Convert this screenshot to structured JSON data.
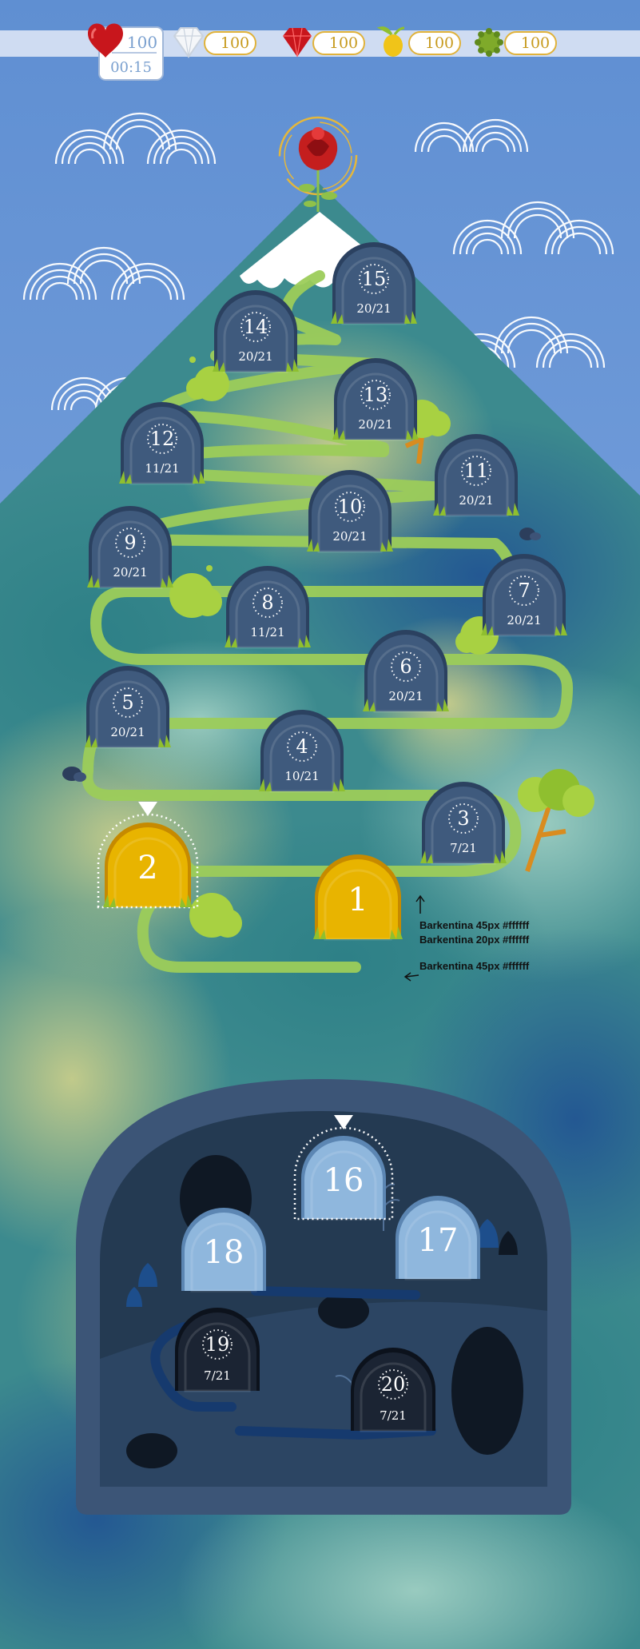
{
  "hud": {
    "lives": {
      "icon": "heart-icon",
      "value": "100",
      "timer": "00:15"
    },
    "currencies": [
      {
        "icon": "white-diamond-icon",
        "value": "100"
      },
      {
        "icon": "red-ruby-icon",
        "value": "100"
      },
      {
        "icon": "golden-fruit-icon",
        "value": "100"
      },
      {
        "icon": "green-gem-icon",
        "value": "100"
      }
    ]
  },
  "goal": {
    "icon": "red-rose-icon"
  },
  "levels": [
    {
      "id": "1",
      "number": "1",
      "state": "unlocked"
    },
    {
      "id": "2",
      "number": "2",
      "state": "current"
    },
    {
      "id": "3",
      "number": "3",
      "progress": "7/21",
      "state": "locked"
    },
    {
      "id": "4",
      "number": "4",
      "progress": "10/21",
      "state": "locked"
    },
    {
      "id": "5",
      "number": "5",
      "progress": "20/21",
      "state": "locked"
    },
    {
      "id": "6",
      "number": "6",
      "progress": "20/21",
      "state": "locked"
    },
    {
      "id": "7",
      "number": "7",
      "progress": "20/21",
      "state": "locked"
    },
    {
      "id": "8",
      "number": "8",
      "progress": "11/21",
      "state": "locked"
    },
    {
      "id": "9",
      "number": "9",
      "progress": "20/21",
      "state": "locked"
    },
    {
      "id": "10",
      "number": "10",
      "progress": "20/21",
      "state": "locked"
    },
    {
      "id": "11",
      "number": "11",
      "progress": "20/21",
      "state": "locked"
    },
    {
      "id": "12",
      "number": "12",
      "progress": "11/21",
      "state": "locked"
    },
    {
      "id": "13",
      "number": "13",
      "progress": "20/21",
      "state": "locked"
    },
    {
      "id": "14",
      "number": "14",
      "progress": "20/21",
      "state": "locked"
    },
    {
      "id": "15",
      "number": "15",
      "progress": "20/21",
      "state": "locked"
    }
  ],
  "cave_levels": [
    {
      "id": "16",
      "number": "16",
      "state": "current"
    },
    {
      "id": "17",
      "number": "17",
      "state": "unlocked"
    },
    {
      "id": "18",
      "number": "18",
      "state": "unlocked"
    },
    {
      "id": "19",
      "number": "19",
      "progress": "7/21",
      "state": "locked"
    },
    {
      "id": "20",
      "number": "20",
      "progress": "7/21",
      "state": "locked"
    }
  ],
  "annotations": {
    "number_font": "Barkentina 45px #ffffff",
    "progress_font": "Barkentina 20px #ffffff",
    "number_font_2": "Barkentina 45px #ffffff"
  },
  "colors": {
    "sky": "#6f9fd9",
    "hud_bar": "#cfdcf2",
    "path": "#9ccc5a",
    "locked": "#3f5a7d",
    "unlocked_gold": "#e8b400",
    "cave_unlocked": "#8fb7dd",
    "cave_locked": "#1b2433"
  }
}
